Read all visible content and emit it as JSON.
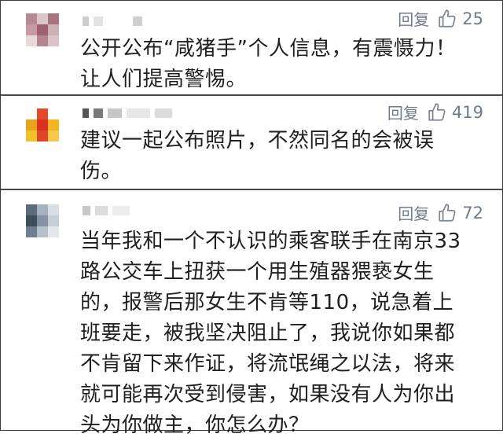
{
  "comments": [
    {
      "reply_label": "回复",
      "likes": "25",
      "text": "公开公布“咸猪手”个人信息，有震慑力！让人们提高警惕。",
      "avatar_icon": "pixelated-avatar-icon"
    },
    {
      "reply_label": "回复",
      "likes": "419",
      "text": "建议一起公布照片，不然同名的会被误伤。",
      "avatar_icon": "pixelated-avatar-icon"
    },
    {
      "reply_label": "回复",
      "likes": "72",
      "text": "当年我和一个不认识的乘客联手在南京33路公交车上扭获一个用生殖器猥亵女生的，报警后那女生不肯等110，说急着上班要走，被我坚决阻止了，我说你如果都不肯留下来作证，将流氓绳之以法，将来就可能再次受到侵害，如果没有人为你出头为你做主，你怎么办？",
      "avatar_icon": "pixelated-avatar-icon"
    }
  ],
  "colors": {
    "meta_gray": "#7b8594",
    "text": "#1f1f1f",
    "divider": "#4a4a4a"
  }
}
